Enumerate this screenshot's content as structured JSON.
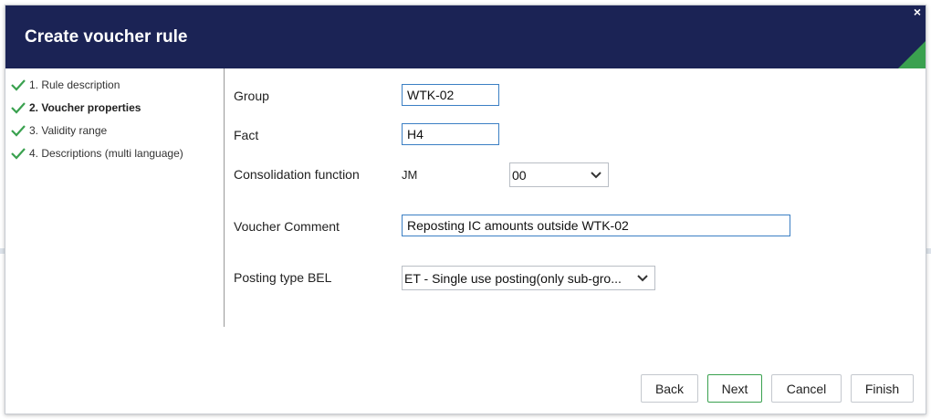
{
  "dialog": {
    "title": "Create voucher rule",
    "close_symbol": "×"
  },
  "steps": [
    {
      "label": "1. Rule description",
      "done": true,
      "active": false
    },
    {
      "label": "2. Voucher properties",
      "done": true,
      "active": true
    },
    {
      "label": "3. Validity range",
      "done": true,
      "active": false
    },
    {
      "label": "4. Descriptions (multi language)",
      "done": true,
      "active": false
    }
  ],
  "form": {
    "group": {
      "label": "Group",
      "value": "WTK-02"
    },
    "fact": {
      "label": "Fact",
      "value": "H4"
    },
    "consolidation": {
      "label": "Consolidation function",
      "code": "JM",
      "selected": "00"
    },
    "comment": {
      "label": "Voucher Comment",
      "value": "Reposting IC amounts outside WTK-02"
    },
    "posting_type": {
      "label": "Posting type BEL",
      "selected": "ET - Single use posting(only sub-gro..."
    }
  },
  "buttons": {
    "back": "Back",
    "next": "Next",
    "cancel": "Cancel",
    "finish": "Finish"
  },
  "colors": {
    "header_bg": "#1b2355",
    "accent_green": "#3aa14f",
    "input_border": "#3b7fc4"
  },
  "icons": {
    "close": "close-icon",
    "check": "checkmark-icon",
    "dropdown": "chevron-down-icon"
  }
}
